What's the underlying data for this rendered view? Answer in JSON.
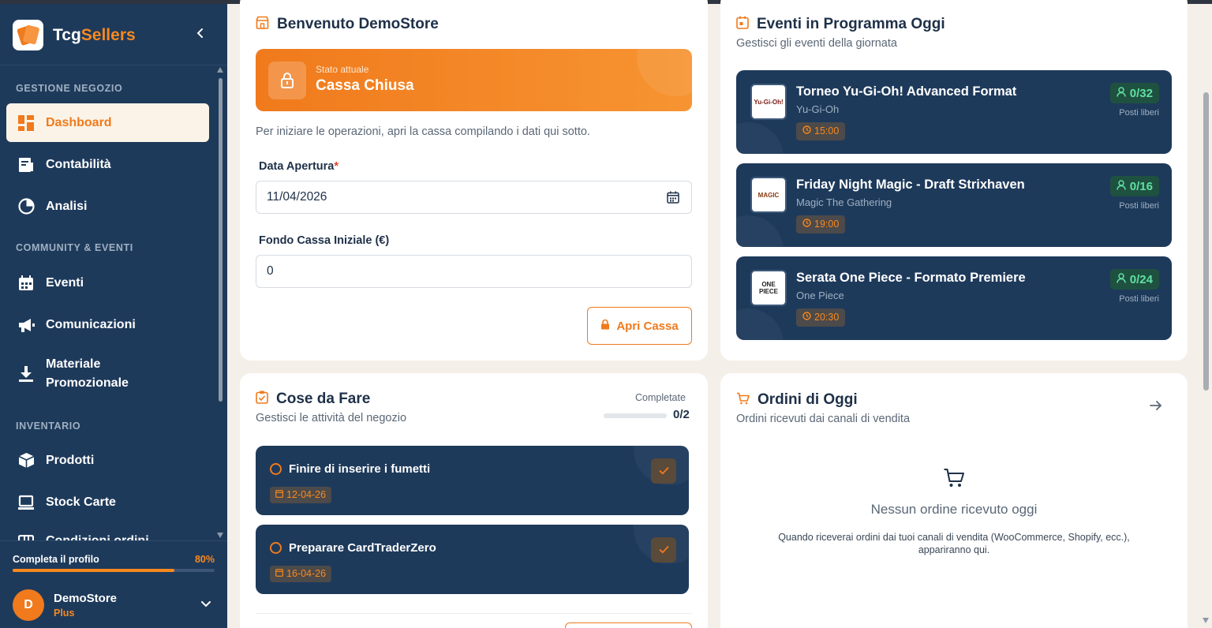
{
  "brand": {
    "name_part1": "Tcg",
    "name_part2": "Sellers"
  },
  "sidebar": {
    "sections": [
      "GESTIONE NEGOZIO",
      "COMMUNITY & EVENTI",
      "INVENTARIO"
    ],
    "items": [
      {
        "label": "Dashboard",
        "icon": "dashboard-icon",
        "active": true
      },
      {
        "label": "Contabilità",
        "icon": "ledger-icon"
      },
      {
        "label": "Analisi",
        "icon": "pie-chart-icon"
      },
      {
        "label": "Eventi",
        "icon": "calendar-icon"
      },
      {
        "label": "Comunicazioni",
        "icon": "megaphone-icon"
      },
      {
        "label": "Materiale",
        "label2": "Promozionale",
        "icon": "download-icon"
      },
      {
        "label": "Prodotti",
        "icon": "box-icon"
      },
      {
        "label": "Stock Carte",
        "icon": "laptop-icon"
      },
      {
        "label": "Condizioni ordini",
        "icon": "grid-icon"
      }
    ],
    "profile": {
      "label": "Completa il profilo",
      "percent": "80%",
      "progress": 0.8
    },
    "user": {
      "initial": "D",
      "name": "DemoStore",
      "plan": "Plus"
    }
  },
  "welcome": {
    "title": "Benvenuto DemoStore",
    "status_small": "Stato attuale",
    "status_big": "Cassa Chiusa",
    "hint": "Per iniziare le operazioni, apri la cassa compilando i dati qui sotto.",
    "date_label": "Data Apertura",
    "date_required": "*",
    "date_value": "11/04/2026",
    "fund_label": "Fondo Cassa Iniziale (€)",
    "fund_value": "0",
    "open_button": "Apri Cassa"
  },
  "events": {
    "title": "Eventi in Programma Oggi",
    "subtitle": "Gestisci gli eventi della giornata",
    "items": [
      {
        "title": "Torneo Yu-Gi-Oh! Advanced Format",
        "game": "Yu-Gi-Oh",
        "time": "15:00",
        "seats": "0/32",
        "free": "Posti liberi",
        "logo": "Yu-Gi-Oh!"
      },
      {
        "title": "Friday Night Magic - Draft Strixhaven",
        "game": "Magic The Gathering",
        "time": "19:00",
        "seats": "0/16",
        "free": "Posti liberi",
        "logo": "MAGIC"
      },
      {
        "title": "Serata One Piece - Formato Premiere",
        "game": "One Piece",
        "time": "20:30",
        "seats": "0/24",
        "free": "Posti liberi",
        "logo": "ONE PIECE"
      }
    ]
  },
  "todo": {
    "title": "Cose da Fare",
    "subtitle": "Gestisci le attività del negozio",
    "done_label": "Completate",
    "count": "0/2",
    "tasks": [
      {
        "title": "Finire di inserire i fumetti",
        "date": "12-04-26"
      },
      {
        "title": "Preparare CardTraderZero",
        "date": "16-04-26"
      }
    ]
  },
  "orders": {
    "title": "Ordini di Oggi",
    "subtitle": "Ordini ricevuti dai canali di vendita",
    "empty_title": "Nessun ordine ricevuto oggi",
    "empty_desc": "Quando riceverai ordini dai tuoi canali di vendita (WooCommerce, Shopify, ecc.), appariranno qui."
  },
  "colors": {
    "accent": "#f07a1c",
    "sidebar": "#1e3a5b",
    "background": "#f4efe8",
    "success": "#5fe0a2"
  }
}
